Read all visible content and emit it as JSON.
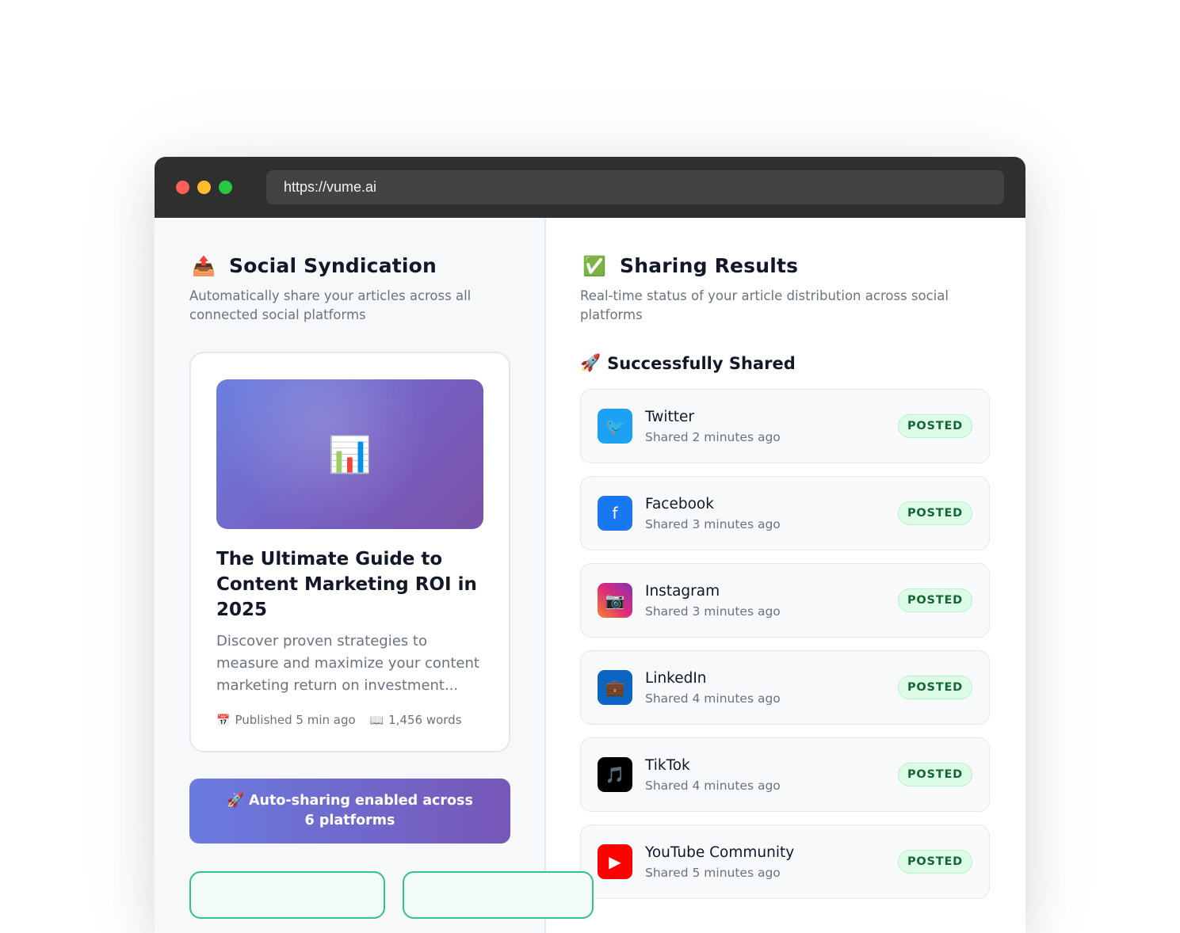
{
  "browser": {
    "url": "https://vume.ai"
  },
  "left": {
    "icon": "outbox-tray-icon",
    "title": "Social Syndication",
    "subtitle": "Automatically share your articles across all connected social platforms",
    "article": {
      "hero_icon": "bar-chart-icon",
      "title": "The Ultimate Guide to Content Marketing ROI in 2025",
      "description": "Discover proven strategies to measure and maximize your content marketing return on investment...",
      "published": "Published 5 min ago",
      "words": "1,456 words"
    },
    "auto_button": "🚀 Auto-sharing enabled across 6 platforms"
  },
  "right": {
    "icon": "check-mark-icon",
    "title": "Sharing Results",
    "subtitle": "Real-time status of your article distribution across social platforms",
    "shared_title": "Successfully Shared",
    "platforms": [
      {
        "name": "Twitter",
        "time": "Shared 2 minutes ago",
        "status": "POSTED",
        "color": "#1da1f2",
        "glyph": "🐦"
      },
      {
        "name": "Facebook",
        "time": "Shared 3 minutes ago",
        "status": "POSTED",
        "color": "#1877f2",
        "glyph": "f"
      },
      {
        "name": "Instagram",
        "time": "Shared 3 minutes ago",
        "status": "POSTED",
        "color": "#e1306c",
        "glyph": "📷"
      },
      {
        "name": "LinkedIn",
        "time": "Shared 4 minutes ago",
        "status": "POSTED",
        "color": "#0a66c2",
        "glyph": "💼"
      },
      {
        "name": "TikTok",
        "time": "Shared 4 minutes ago",
        "status": "POSTED",
        "color": "#000000",
        "glyph": "🎵"
      },
      {
        "name": "YouTube Community",
        "time": "Shared 5 minutes ago",
        "status": "POSTED",
        "color": "#ff0000",
        "glyph": "▶"
      }
    ]
  }
}
